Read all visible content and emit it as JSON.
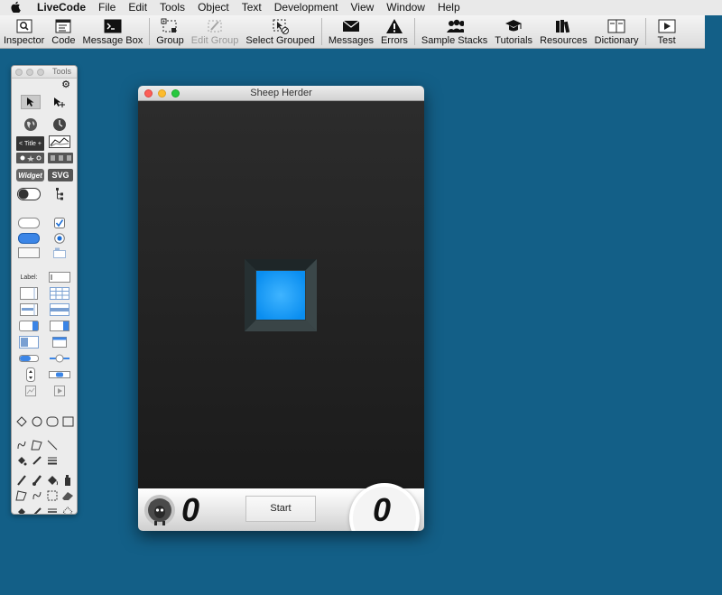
{
  "menubar": {
    "apple_icon": "apple-logo",
    "items": [
      "LiveCode",
      "File",
      "Edit",
      "Tools",
      "Object",
      "Text",
      "Development",
      "View",
      "Window",
      "Help"
    ]
  },
  "toolbar": {
    "items": [
      {
        "label": "Inspector",
        "icon": "inspector-icon",
        "enabled": true
      },
      {
        "label": "Code",
        "icon": "code-icon",
        "enabled": true
      },
      {
        "label": "Message Box",
        "icon": "message-box-icon",
        "enabled": true
      },
      {
        "label": "Group",
        "icon": "group-icon",
        "enabled": true
      },
      {
        "label": "Edit Group",
        "icon": "edit-group-icon",
        "enabled": false
      },
      {
        "label": "Select Grouped",
        "icon": "select-grouped-icon",
        "enabled": true
      },
      {
        "label": "Messages",
        "icon": "messages-icon",
        "enabled": true
      },
      {
        "label": "Errors",
        "icon": "errors-icon",
        "enabled": true
      },
      {
        "label": "Sample Stacks",
        "icon": "sample-stacks-icon",
        "enabled": true
      },
      {
        "label": "Tutorials",
        "icon": "tutorials-icon",
        "enabled": true
      },
      {
        "label": "Resources",
        "icon": "resources-icon",
        "enabled": true
      },
      {
        "label": "Dictionary",
        "icon": "dictionary-icon",
        "enabled": true
      },
      {
        "label": "Test",
        "icon": "test-icon",
        "enabled": true
      }
    ]
  },
  "tools_palette": {
    "title": "Tools",
    "widget_label": "Widget",
    "svg_label": "SVG",
    "title_label": "< Title +",
    "field_label": "Label:"
  },
  "game_window": {
    "title": "Sheep Herder",
    "score_left": "0",
    "start_label": "Start",
    "score_right": "0",
    "accent_color": "#1aa7ff"
  }
}
